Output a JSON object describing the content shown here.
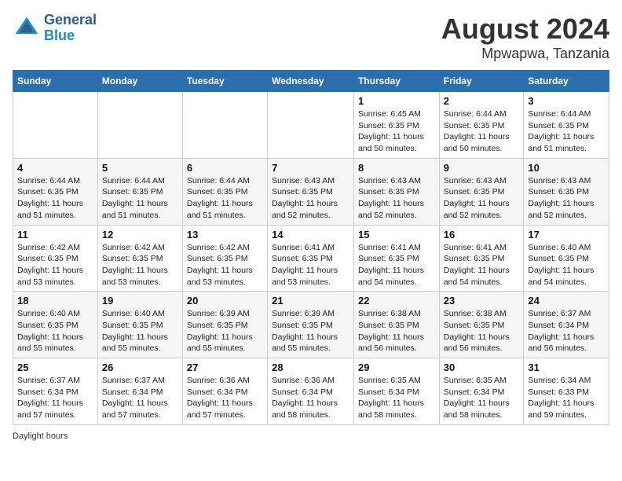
{
  "header": {
    "logo_line1": "General",
    "logo_line2": "Blue",
    "month": "August 2024",
    "location": "Mpwapwa, Tanzania"
  },
  "days_of_week": [
    "Sunday",
    "Monday",
    "Tuesday",
    "Wednesday",
    "Thursday",
    "Friday",
    "Saturday"
  ],
  "weeks": [
    [
      {
        "day": "",
        "info": ""
      },
      {
        "day": "",
        "info": ""
      },
      {
        "day": "",
        "info": ""
      },
      {
        "day": "",
        "info": ""
      },
      {
        "day": "1",
        "info": "Sunrise: 6:45 AM\nSunset: 6:35 PM\nDaylight: 11 hours\nand 50 minutes."
      },
      {
        "day": "2",
        "info": "Sunrise: 6:44 AM\nSunset: 6:35 PM\nDaylight: 11 hours\nand 50 minutes."
      },
      {
        "day": "3",
        "info": "Sunrise: 6:44 AM\nSunset: 6:35 PM\nDaylight: 11 hours\nand 51 minutes."
      }
    ],
    [
      {
        "day": "4",
        "info": "Sunrise: 6:44 AM\nSunset: 6:35 PM\nDaylight: 11 hours\nand 51 minutes."
      },
      {
        "day": "5",
        "info": "Sunrise: 6:44 AM\nSunset: 6:35 PM\nDaylight: 11 hours\nand 51 minutes."
      },
      {
        "day": "6",
        "info": "Sunrise: 6:44 AM\nSunset: 6:35 PM\nDaylight: 11 hours\nand 51 minutes."
      },
      {
        "day": "7",
        "info": "Sunrise: 6:43 AM\nSunset: 6:35 PM\nDaylight: 11 hours\nand 52 minutes."
      },
      {
        "day": "8",
        "info": "Sunrise: 6:43 AM\nSunset: 6:35 PM\nDaylight: 11 hours\nand 52 minutes."
      },
      {
        "day": "9",
        "info": "Sunrise: 6:43 AM\nSunset: 6:35 PM\nDaylight: 11 hours\nand 52 minutes."
      },
      {
        "day": "10",
        "info": "Sunrise: 6:43 AM\nSunset: 6:35 PM\nDaylight: 11 hours\nand 52 minutes."
      }
    ],
    [
      {
        "day": "11",
        "info": "Sunrise: 6:42 AM\nSunset: 6:35 PM\nDaylight: 11 hours\nand 53 minutes."
      },
      {
        "day": "12",
        "info": "Sunrise: 6:42 AM\nSunset: 6:35 PM\nDaylight: 11 hours\nand 53 minutes."
      },
      {
        "day": "13",
        "info": "Sunrise: 6:42 AM\nSunset: 6:35 PM\nDaylight: 11 hours\nand 53 minutes."
      },
      {
        "day": "14",
        "info": "Sunrise: 6:41 AM\nSunset: 6:35 PM\nDaylight: 11 hours\nand 53 minutes."
      },
      {
        "day": "15",
        "info": "Sunrise: 6:41 AM\nSunset: 6:35 PM\nDaylight: 11 hours\nand 54 minutes."
      },
      {
        "day": "16",
        "info": "Sunrise: 6:41 AM\nSunset: 6:35 PM\nDaylight: 11 hours\nand 54 minutes."
      },
      {
        "day": "17",
        "info": "Sunrise: 6:40 AM\nSunset: 6:35 PM\nDaylight: 11 hours\nand 54 minutes."
      }
    ],
    [
      {
        "day": "18",
        "info": "Sunrise: 6:40 AM\nSunset: 6:35 PM\nDaylight: 11 hours\nand 55 minutes."
      },
      {
        "day": "19",
        "info": "Sunrise: 6:40 AM\nSunset: 6:35 PM\nDaylight: 11 hours\nand 55 minutes."
      },
      {
        "day": "20",
        "info": "Sunrise: 6:39 AM\nSunset: 6:35 PM\nDaylight: 11 hours\nand 55 minutes."
      },
      {
        "day": "21",
        "info": "Sunrise: 6:39 AM\nSunset: 6:35 PM\nDaylight: 11 hours\nand 55 minutes."
      },
      {
        "day": "22",
        "info": "Sunrise: 6:38 AM\nSunset: 6:35 PM\nDaylight: 11 hours\nand 56 minutes."
      },
      {
        "day": "23",
        "info": "Sunrise: 6:38 AM\nSunset: 6:35 PM\nDaylight: 11 hours\nand 56 minutes."
      },
      {
        "day": "24",
        "info": "Sunrise: 6:37 AM\nSunset: 6:34 PM\nDaylight: 11 hours\nand 56 minutes."
      }
    ],
    [
      {
        "day": "25",
        "info": "Sunrise: 6:37 AM\nSunset: 6:34 PM\nDaylight: 11 hours\nand 57 minutes."
      },
      {
        "day": "26",
        "info": "Sunrise: 6:37 AM\nSunset: 6:34 PM\nDaylight: 11 hours\nand 57 minutes."
      },
      {
        "day": "27",
        "info": "Sunrise: 6:36 AM\nSunset: 6:34 PM\nDaylight: 11 hours\nand 57 minutes."
      },
      {
        "day": "28",
        "info": "Sunrise: 6:36 AM\nSunset: 6:34 PM\nDaylight: 11 hours\nand 58 minutes."
      },
      {
        "day": "29",
        "info": "Sunrise: 6:35 AM\nSunset: 6:34 PM\nDaylight: 11 hours\nand 58 minutes."
      },
      {
        "day": "30",
        "info": "Sunrise: 6:35 AM\nSunset: 6:34 PM\nDaylight: 11 hours\nand 58 minutes."
      },
      {
        "day": "31",
        "info": "Sunrise: 6:34 AM\nSunset: 6:33 PM\nDaylight: 11 hours\nand 59 minutes."
      }
    ]
  ],
  "footer": {
    "label": "Daylight hours"
  }
}
